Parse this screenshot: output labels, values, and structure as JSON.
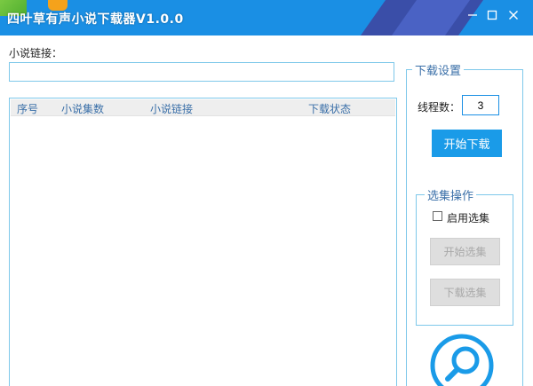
{
  "window": {
    "title": "四叶草有声小说下载器V1.0.0",
    "minimize_icon": "minimize-icon",
    "maximize_icon": "maximize-icon",
    "close_icon": "close-icon"
  },
  "url_section": {
    "label": "小说链接：",
    "input_value": "",
    "input_placeholder": ""
  },
  "list": {
    "columns": [
      "序号",
      "小说集数",
      "小说链接",
      "下载状态"
    ],
    "rows": []
  },
  "download_settings": {
    "title": "下载设置",
    "thread_label": "线程数：",
    "thread_value": "3",
    "start_button": "开始下载"
  },
  "chapter_ops": {
    "title": "选集操作",
    "enable_label": "启用选集",
    "enable_checked": false,
    "start_select_button": "开始选集",
    "download_select_button": "下载选集"
  },
  "logo_icon": "search-logo-icon",
  "colors": {
    "titlebar": "#1a8fe4",
    "accent_border": "#7ec8ea",
    "primary_button": "#1a9be8",
    "disabled_button": "#dedede",
    "header_text": "#3a6fa8"
  }
}
